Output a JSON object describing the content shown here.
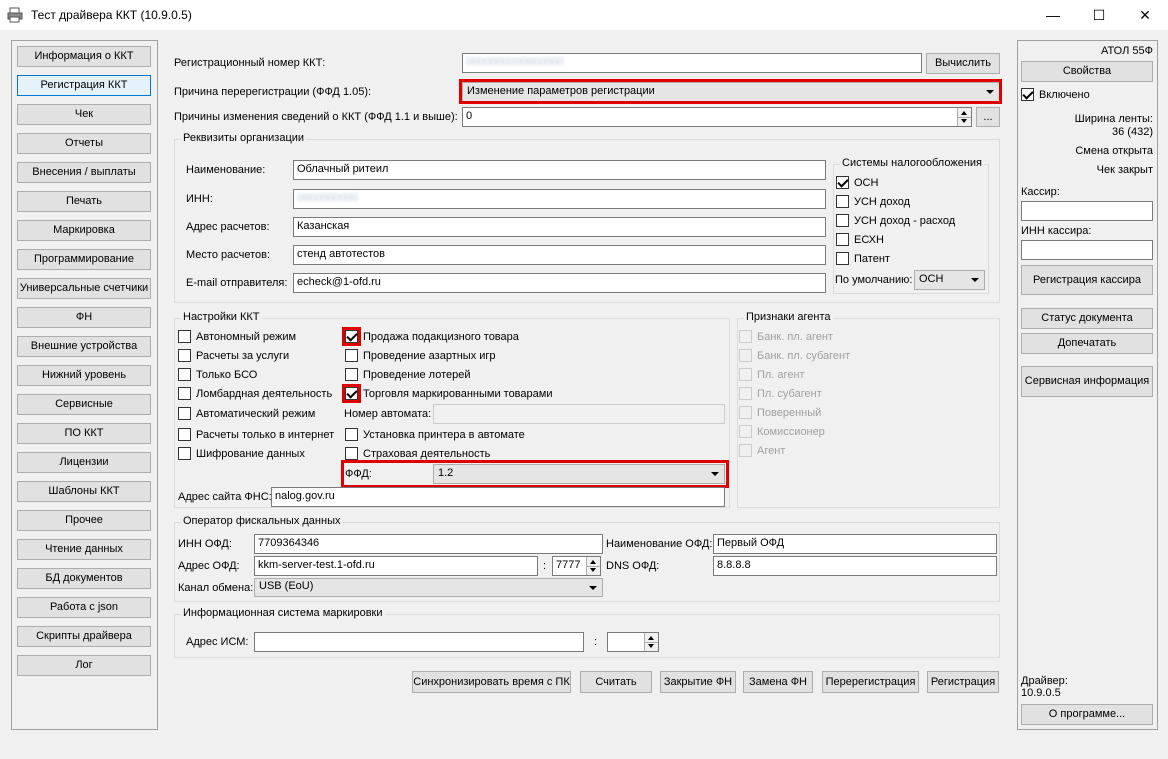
{
  "window": {
    "title": "Тест драйвера ККТ (10.9.0.5)",
    "minimize": "—",
    "maximize": "☐",
    "close": "✕"
  },
  "left_nav": [
    "Информация о ККТ",
    "Регистрация ККТ",
    "Чек",
    "Отчеты",
    "Внесения / выплаты",
    "Печать",
    "Маркировка",
    "Программирование",
    "Универсальные счетчики",
    "ФН",
    "Внешние устройства",
    "Нижний уровень",
    "Сервисные",
    "ПО ККТ",
    "Лицензии",
    "Шаблоны ККТ",
    "Прочее",
    "Чтение данных",
    "БД документов",
    "Работа с json",
    "Скрипты драйвера",
    "Лог"
  ],
  "registration": {
    "reg_number_label": "Регистрационный номер ККТ:",
    "reg_number_value": "0000000000000000",
    "calculate_btn": "Вычислить",
    "reason_label": "Причина перерегистрации (ФФД 1.05):",
    "reason_value": "Изменение параметров регистрации",
    "change_reasons_label": "Причины изменения сведений о ККТ (ФФД 1.1 и выше):",
    "change_reasons_value": "0",
    "more_btn": "..."
  },
  "org": {
    "title": "Реквизиты организации",
    "name_label": "Наименование:",
    "name_value": "Облачный ритеил",
    "inn_label": "ИНН:",
    "inn_value": "0000000000",
    "address_label": "Адрес расчетов:",
    "address_value": "Казанская",
    "place_label": "Место расчетов:",
    "place_value": "стенд автотестов",
    "email_label": "E-mail отправителя:",
    "email_value": "echeck@1-ofd.ru"
  },
  "tax": {
    "title": "Системы налогообложения",
    "items": [
      {
        "label": "ОСН",
        "checked": true
      },
      {
        "label": "УСН доход",
        "checked": false
      },
      {
        "label": "УСН доход - расход",
        "checked": false
      },
      {
        "label": "ЕСХН",
        "checked": false
      },
      {
        "label": "Патент",
        "checked": false
      }
    ],
    "default_label": "По умолчанию:",
    "default_value": "ОСН"
  },
  "kkt_settings": {
    "title": "Настройки ККТ",
    "col1": [
      {
        "label": "Автономный режим",
        "checked": false
      },
      {
        "label": "Расчеты за услуги",
        "checked": false
      },
      {
        "label": "Только БСО",
        "checked": false
      },
      {
        "label": "Ломбардная деятельность",
        "checked": false
      },
      {
        "label": "Автоматический режим",
        "checked": false
      },
      {
        "label": "Расчеты только в интернет",
        "checked": false
      },
      {
        "label": "Шифрование данных",
        "checked": false
      }
    ],
    "col2": [
      {
        "label": "Продажа подакцизного товара",
        "checked": true
      },
      {
        "label": "Проведение азартных игр",
        "checked": false
      },
      {
        "label": "Проведение лотерей",
        "checked": false
      },
      {
        "label": "Торговля маркированными товарами",
        "checked": true
      }
    ],
    "automat_label": "Номер автомата:",
    "automat_value": "",
    "col2b": [
      {
        "label": "Установка принтера в автомате",
        "checked": false
      },
      {
        "label": "Страховая деятельность",
        "checked": false
      }
    ],
    "ffd_label": "ФФД:",
    "ffd_value": "1.2",
    "fns_label": "Адрес сайта ФНС:",
    "fns_value": "nalog.gov.ru"
  },
  "agent": {
    "title": "Признаки агента",
    "items": [
      "Банк. пл. агент",
      "Банк. пл. субагент",
      "Пл. агент",
      "Пл. субагент",
      "Поверенный",
      "Комиссионер",
      "Агент"
    ]
  },
  "ofd": {
    "title": "Оператор фискальных данных",
    "inn_label": "ИНН ОФД:",
    "inn_value": "7709364346",
    "name_label": "Наименование ОФД:",
    "name_value": "Первый ОФД",
    "address_label": "Адрес ОФД:",
    "address_value": "kkm-server-test.1-ofd.ru",
    "port_sep": ":",
    "port_value": "7777",
    "dns_label": "DNS ОФД:",
    "dns_value": "8.8.8.8",
    "channel_label": "Канал обмена:",
    "channel_value": "USB (EoU)"
  },
  "ism": {
    "title": "Информационная система маркировки",
    "address_label": "Адрес ИСМ:",
    "address_value": "",
    "port_sep": ":",
    "port_value": ""
  },
  "actions": [
    "Синхронизировать время с ПК",
    "Считать",
    "Закрытие ФН",
    "Замена ФН",
    "Перерегистрация",
    "Регистрация"
  ],
  "right": {
    "model": "АТОЛ 55Ф",
    "properties_btn": "Свойства",
    "enabled_label": "Включено",
    "tape_label": "Ширина ленты:",
    "tape_value": "36 (432)",
    "shift_status": "Смена открыта",
    "receipt_status": "Чек закрыт",
    "cashier_label": "Кассир:",
    "cashier_value": "",
    "cashier_inn_label": "ИНН кассира:",
    "cashier_inn_value": "",
    "register_cashier_btn": "Регистрация кассира",
    "doc_status_btn": "Статус документа",
    "reprint_btn": "Допечатать",
    "service_info_btn": "Сервисная информация",
    "driver_label": "Драйвер:",
    "driver_version": "10.9.0.5",
    "about_btn": "О программе..."
  }
}
